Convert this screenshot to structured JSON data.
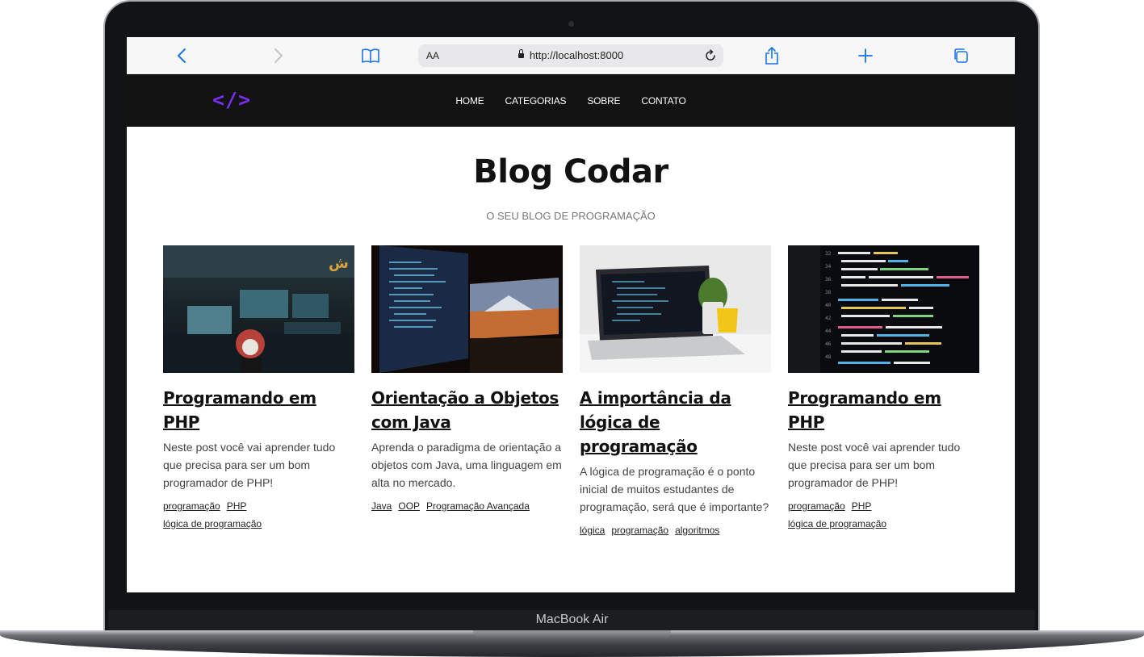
{
  "device": {
    "label": "MacBook Air"
  },
  "browser": {
    "text_size_label": "AA",
    "url": "http://localhost:8000",
    "icons": [
      "chevron-left-icon",
      "chevron-right-icon",
      "book-icon",
      "lock-icon",
      "reload-icon",
      "share-icon",
      "plus-icon",
      "tabs-icon"
    ],
    "accent_color": "#1a73e8"
  },
  "site": {
    "logo_text": "</>",
    "logo_color": "#7b2cf5",
    "nav": [
      {
        "label": "HOME"
      },
      {
        "label": "CATEGORIAS"
      },
      {
        "label": "SOBRE"
      },
      {
        "label": "CONTATO"
      }
    ],
    "title": "Blog Codar",
    "subtitle": "O SEU BLOG DE PROGRAMAÇÃO",
    "posts": [
      {
        "title": "Programando em PHP",
        "description": "Neste post você vai aprender tudo que precisa para ser um bom programador de PHP!",
        "tags": [
          "programação",
          "PHP",
          "lógica de programação"
        ]
      },
      {
        "title": "Orientação a Objetos com Java",
        "description": "Aprenda o paradigma de orientação a objetos com Java, uma linguagem em alta no mercado.",
        "tags": [
          "Java",
          "OOP",
          "Programação Avançada"
        ]
      },
      {
        "title": "A importância da lógica de programação",
        "description": "A lógica de programação é o ponto inicial de muitos estudantes de programação, será que é importante?",
        "tags": [
          "lógica",
          "programação",
          "algoritmos"
        ]
      },
      {
        "title": "Programando em PHP",
        "description": "Neste post você vai aprender tudo que precisa para ser um bom programador de PHP!",
        "tags": [
          "programação",
          "PHP",
          "lógica de programação"
        ]
      }
    ]
  }
}
